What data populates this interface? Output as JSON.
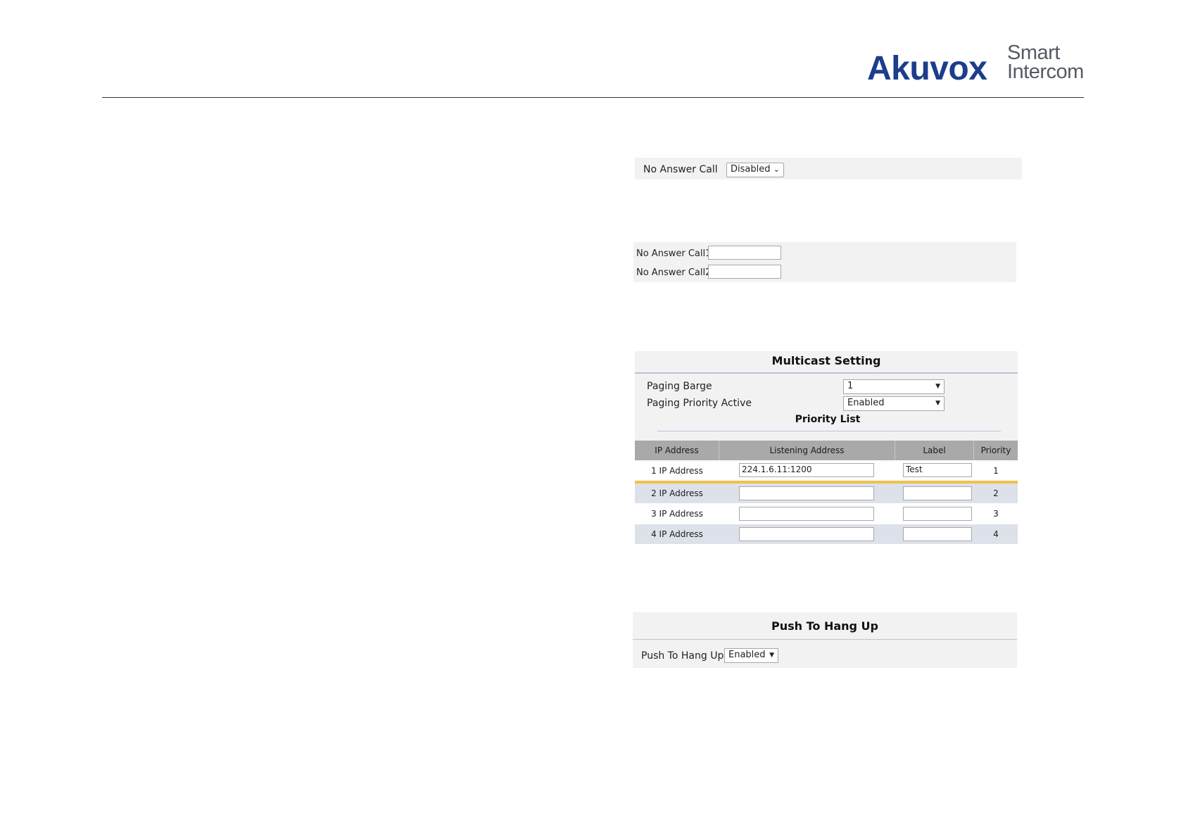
{
  "brand": {
    "main": "Akuvox",
    "sub_line1": "Smart",
    "sub_line2": "Intercom"
  },
  "no_answer_call": {
    "label": "No Answer Call",
    "value": "Disabled"
  },
  "no_answer_numbers": {
    "call1_label": "No Answer Call1",
    "call1_value": "",
    "call2_label": "No Answer Call2",
    "call2_value": ""
  },
  "multicast": {
    "title": "Multicast Setting",
    "paging_barge_label": "Paging Barge",
    "paging_barge_value": "1",
    "paging_priority_label": "Paging Priority Active",
    "paging_priority_value": "Enabled",
    "priority_list_title": "Priority List",
    "columns": [
      "IP Address",
      "Listening Address",
      "Label",
      "Priority"
    ],
    "rows": [
      {
        "name": "1 IP Address",
        "address": "224.1.6.11:1200",
        "label": "Test",
        "priority": "1"
      },
      {
        "name": "2 IP Address",
        "address": "",
        "label": "",
        "priority": "2"
      },
      {
        "name": "3 IP Address",
        "address": "",
        "label": "",
        "priority": "3"
      },
      {
        "name": "4 IP Address",
        "address": "",
        "label": "",
        "priority": "4"
      }
    ]
  },
  "push_to_hang_up": {
    "title": "Push To Hang Up",
    "label": "Push To Hang Up",
    "value": "Enabled"
  }
}
